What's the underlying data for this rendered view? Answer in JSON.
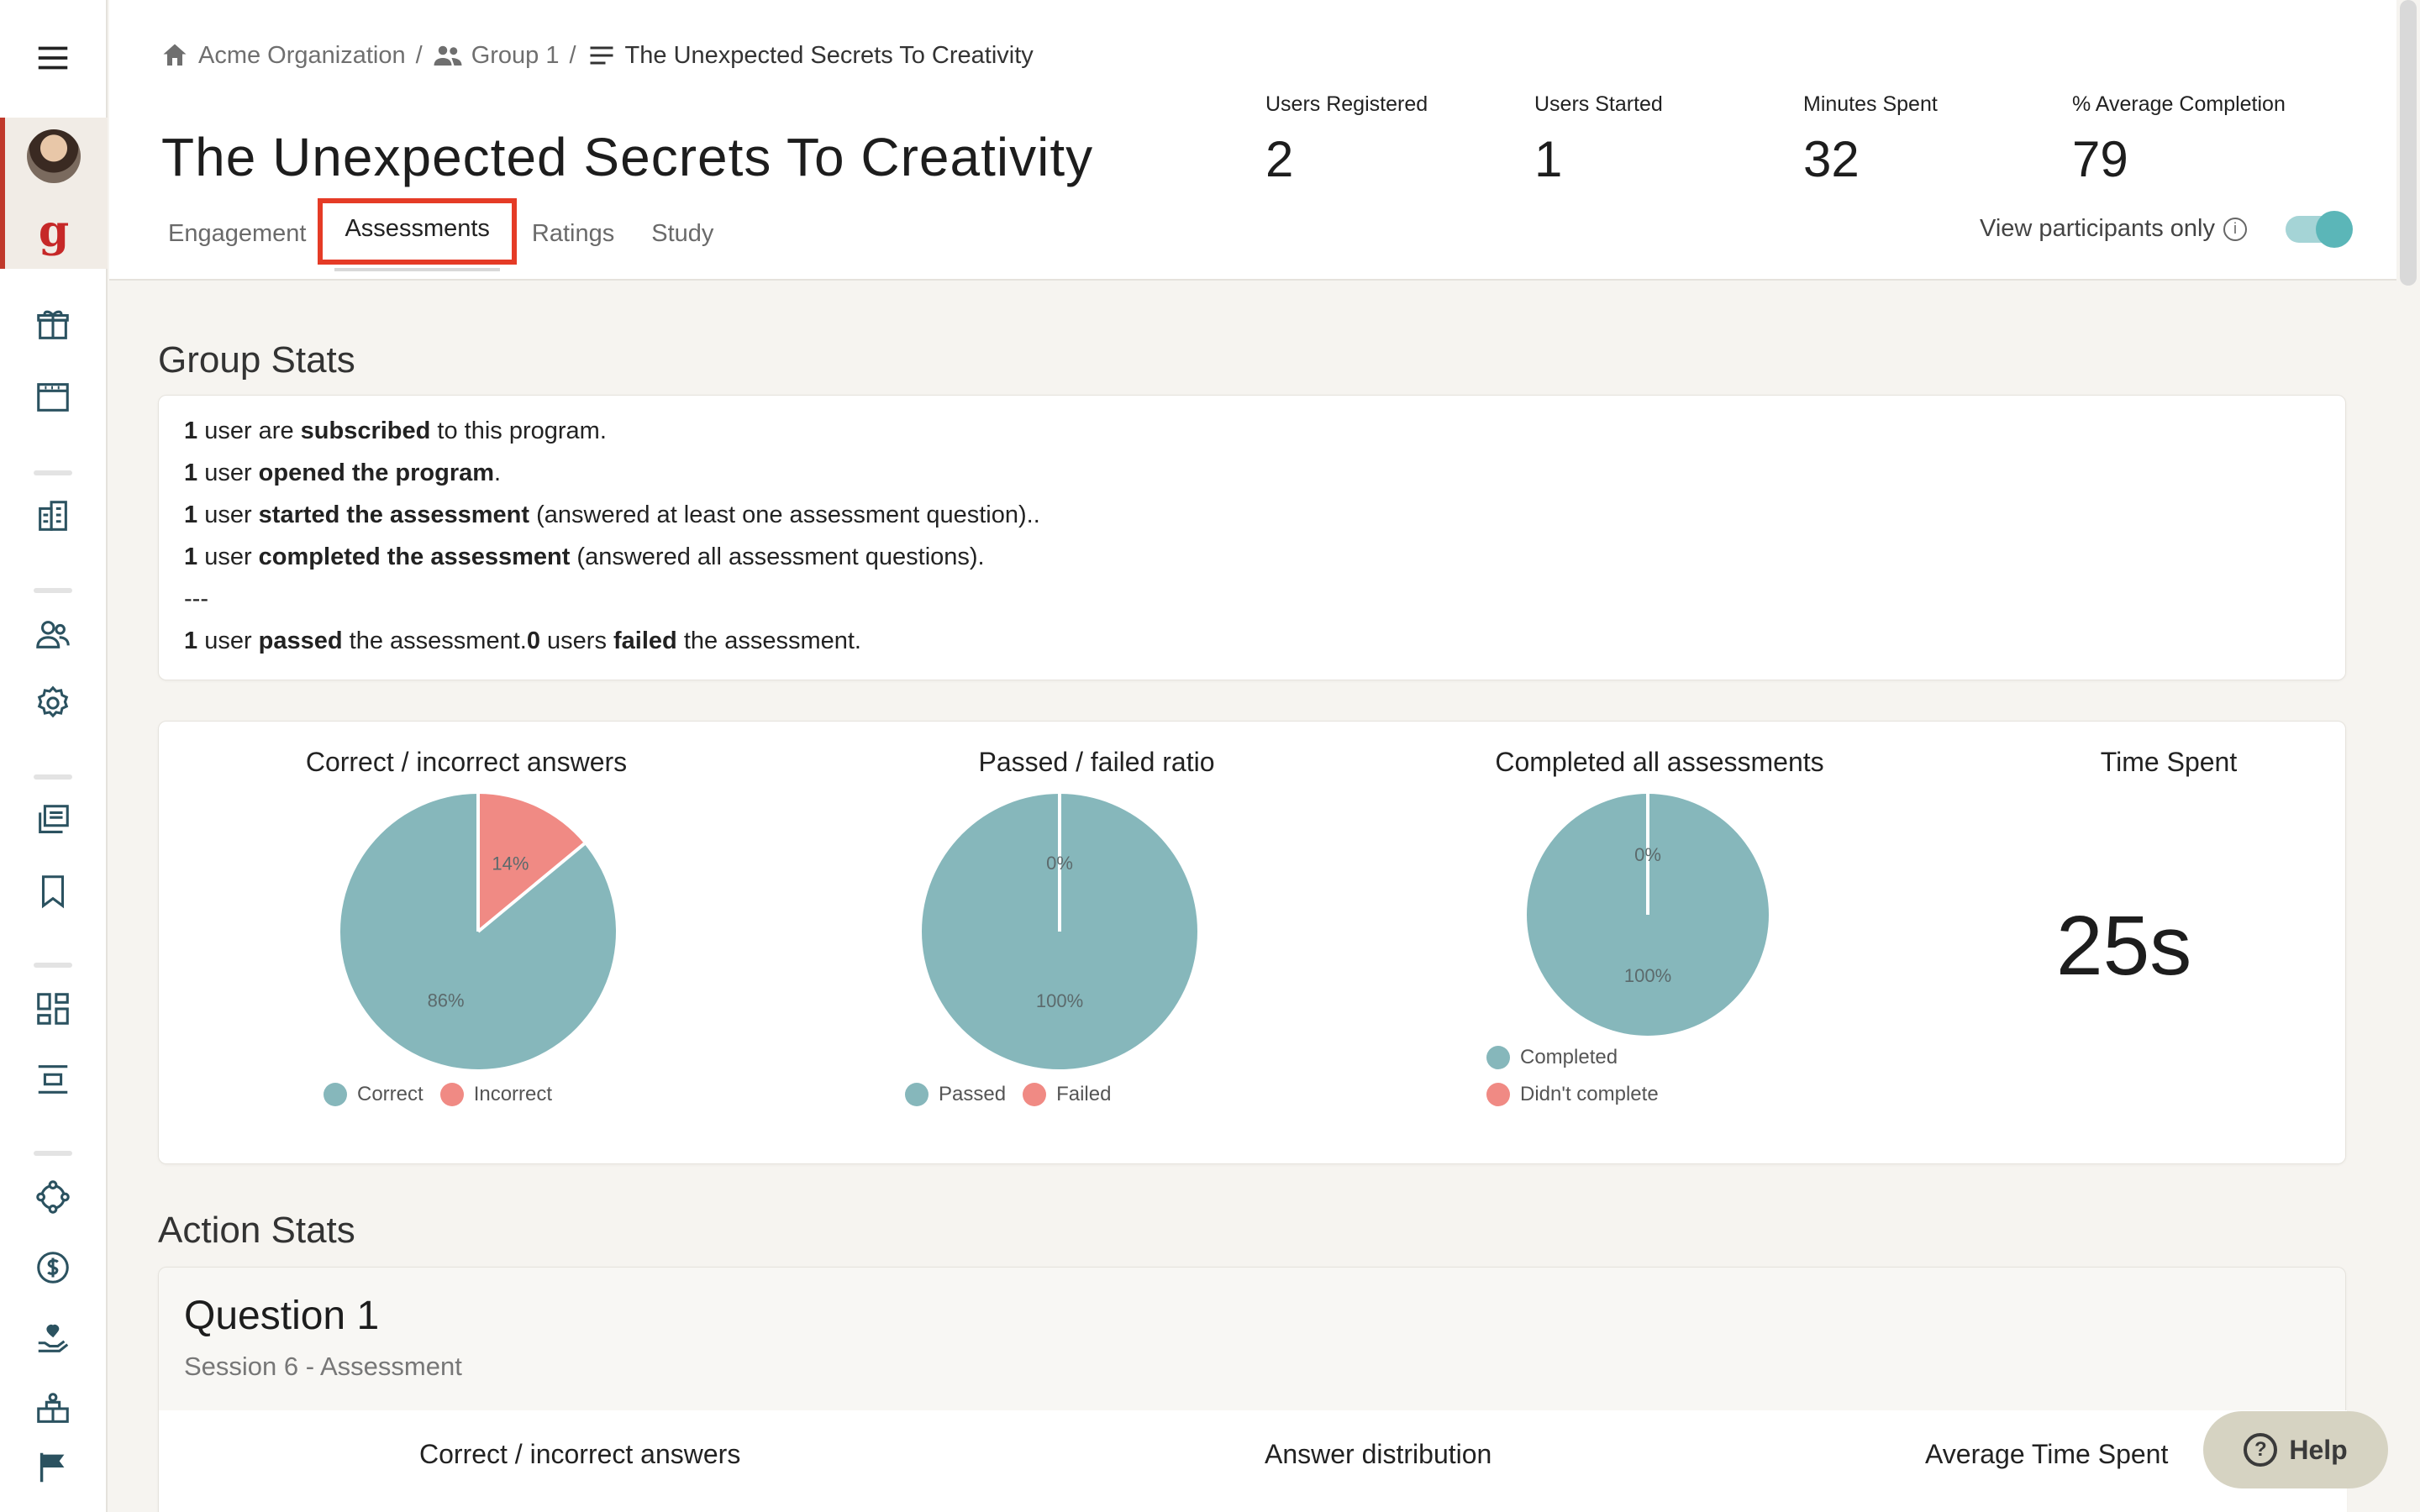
{
  "breadcrumb": {
    "org": "Acme Organization",
    "group": "Group 1",
    "program": "The Unexpected Secrets To Creativity",
    "sep": "/"
  },
  "title": "The Unexpected Secrets To Creativity",
  "stats": [
    {
      "label": "Users Registered",
      "value": "2"
    },
    {
      "label": "Users Started",
      "value": "1"
    },
    {
      "label": "Minutes Spent",
      "value": "32"
    },
    {
      "label": "% Average Completion",
      "value": "79"
    }
  ],
  "tabs": [
    "Engagement",
    "Assessments",
    "Ratings",
    "Study"
  ],
  "active_tab": "Assessments",
  "toggle": {
    "label": "View participants only",
    "on": true
  },
  "group_stats": {
    "title": "Group Stats",
    "lines": [
      {
        "n": "1",
        "a": " user are ",
        "b": "subscribed",
        "c": " to this program."
      },
      {
        "n": "1",
        "a": " user ",
        "b": "opened the program",
        "c": "."
      },
      {
        "n": "1",
        "a": " user ",
        "b": "started the assessment",
        "c": " (answered at least one assessment question).."
      },
      {
        "n": "1",
        "a": " user ",
        "b": "completed the assessment",
        "c": " (answered all assessment questions)."
      }
    ],
    "divider": "---",
    "result": {
      "n1": "1",
      "t1": " user ",
      "b1": "passed",
      "t2": " the assessment.",
      "n2": "0",
      "t3": " users ",
      "b2": "failed",
      "t4": " the assessment."
    }
  },
  "charts": [
    {
      "title": "Correct / incorrect answers",
      "labels": [
        "86%",
        "14%"
      ],
      "legend": [
        "Correct",
        "Incorrect"
      ]
    },
    {
      "title": "Passed / failed ratio",
      "labels": [
        "100%",
        "0%"
      ],
      "legend": [
        "Passed",
        "Failed"
      ]
    },
    {
      "title": "Completed all assessments",
      "labels": [
        "100%",
        "0%"
      ],
      "legend": [
        "Completed",
        "Didn't complete"
      ]
    }
  ],
  "time_spent": {
    "title": "Time Spent",
    "value": "25s"
  },
  "action_stats": {
    "title": "Action Stats",
    "question": "Question 1",
    "session": "Session 6 - Assessment",
    "heads": [
      "Correct / incorrect answers",
      "Answer distribution",
      "Average Time Spent"
    ]
  },
  "colors": {
    "teal": "#86b7bb",
    "salmon": "#f08a84",
    "accent_red": "#e53b26"
  },
  "help": "Help",
  "chart_data": [
    {
      "type": "pie",
      "title": "Correct / incorrect answers",
      "categories": [
        "Correct",
        "Incorrect"
      ],
      "values": [
        86,
        14
      ]
    },
    {
      "type": "pie",
      "title": "Passed / failed ratio",
      "categories": [
        "Passed",
        "Failed"
      ],
      "values": [
        100,
        0
      ]
    },
    {
      "type": "pie",
      "title": "Completed all assessments",
      "categories": [
        "Completed",
        "Didn't complete"
      ],
      "values": [
        100,
        0
      ]
    }
  ]
}
